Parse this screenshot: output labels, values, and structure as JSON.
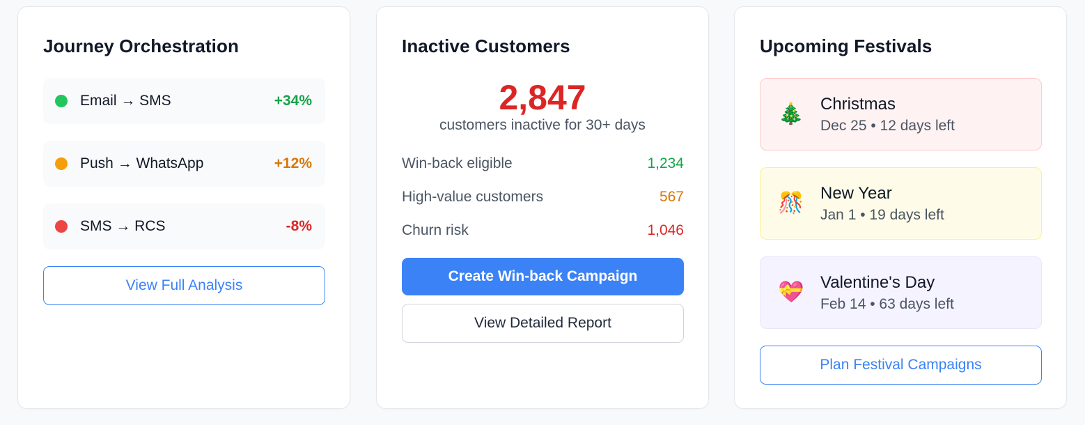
{
  "journey": {
    "title": "Journey Orchestration",
    "rows": [
      {
        "label": "Email → SMS",
        "change": "+34%",
        "dot_color": "#22c55e",
        "change_color": "#16a34a"
      },
      {
        "label": "Push → WhatsApp",
        "change": "+12%",
        "dot_color": "#f59e0b",
        "change_color": "#d97706"
      },
      {
        "label": "SMS → RCS",
        "change": "-8%",
        "dot_color": "#ef4444",
        "change_color": "#dc2626"
      }
    ],
    "button": "View Full Analysis"
  },
  "inactive": {
    "title": "Inactive Customers",
    "count": "2,847",
    "subtitle": "customers inactive for 30+ days",
    "stats": [
      {
        "label": "Win-back eligible",
        "value": "1,234",
        "color": "#16a34a"
      },
      {
        "label": "High-value customers",
        "value": "567",
        "color": "#d97706"
      },
      {
        "label": "Churn risk",
        "value": "1,046",
        "color": "#dc2626"
      }
    ],
    "primary_button": "Create Win-back Campaign",
    "secondary_button": "View Detailed Report"
  },
  "festivals": {
    "title": "Upcoming Festivals",
    "items": [
      {
        "name": "Christmas",
        "meta": "Dec 25 • 12 days left",
        "icon": "christmas-tree-icon",
        "glyph": "🎄",
        "bg": "#fef2f2",
        "border": "#fecaca"
      },
      {
        "name": "New Year",
        "meta": "Jan 1 • 19 days left",
        "icon": "party-popper-icon",
        "glyph": "🎊",
        "bg": "#fefce8",
        "border": "#fef08a"
      },
      {
        "name": "Valentine's Day",
        "meta": "Feb 14 • 63 days left",
        "icon": "heart-gift-icon",
        "glyph": "💝",
        "bg": "#f5f3ff",
        "border": "#e9e5fb"
      }
    ],
    "button": "Plan Festival Campaigns"
  },
  "colors": {
    "accent": "#3b82f6",
    "positive": "#16a34a",
    "warning": "#d97706",
    "negative": "#dc2626"
  }
}
